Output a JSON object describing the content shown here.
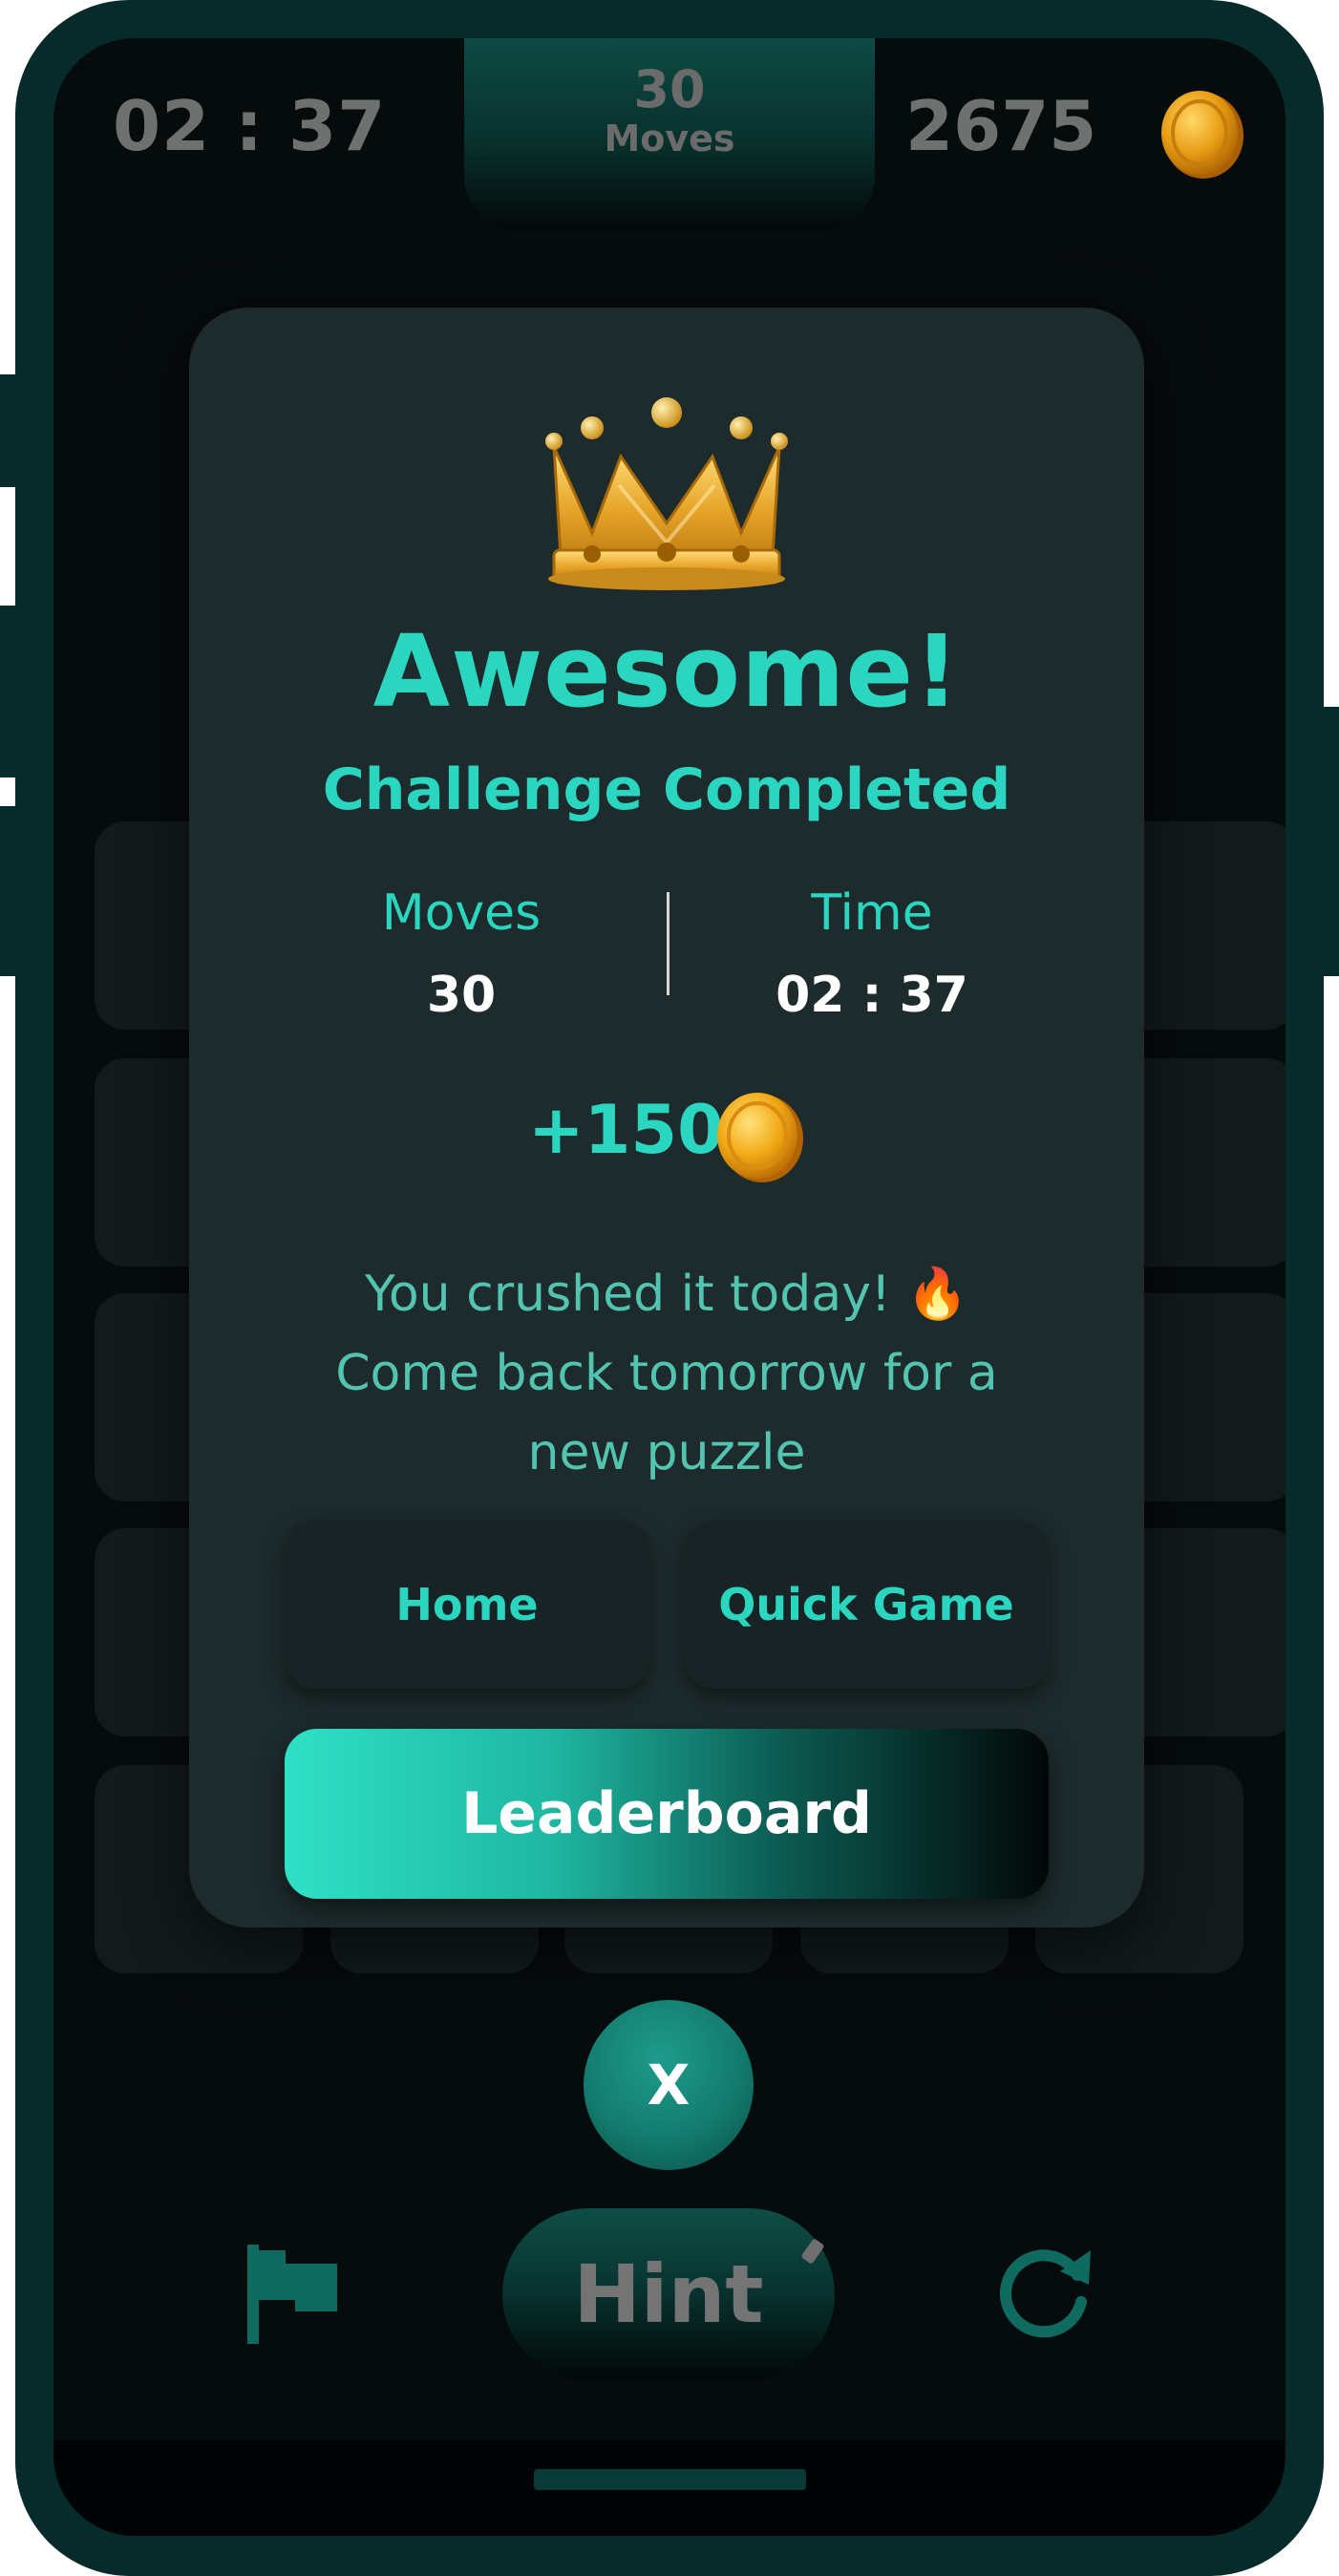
{
  "header": {
    "timer": "02 : 37",
    "moves_count": "30",
    "moves_label": "Moves",
    "coins": "2675"
  },
  "modal": {
    "title": "Awesome!",
    "subtitle": "Challenge Completed",
    "stats": [
      {
        "label": "Moves",
        "value": "30"
      },
      {
        "label": "Time",
        "value": "02 : 37"
      }
    ],
    "reward": "+150",
    "message_lines": [
      "You crushed it today! 🔥",
      "Come back tomorrow for a",
      "new puzzle"
    ],
    "home_label": "Home",
    "quick_game_label": "Quick Game",
    "leaderboard_label": "Leaderboard"
  },
  "controls": {
    "close_label": "X",
    "hint_label": "Hint"
  },
  "icons": [
    "coin-icon",
    "crown-icon",
    "flag-icon",
    "refresh-icon",
    "fire-emoji"
  ],
  "colors": {
    "accent": "#2bd6c0",
    "frame": "#062b2a",
    "card": "#1d2b2d",
    "coin": "#f3a81c"
  }
}
